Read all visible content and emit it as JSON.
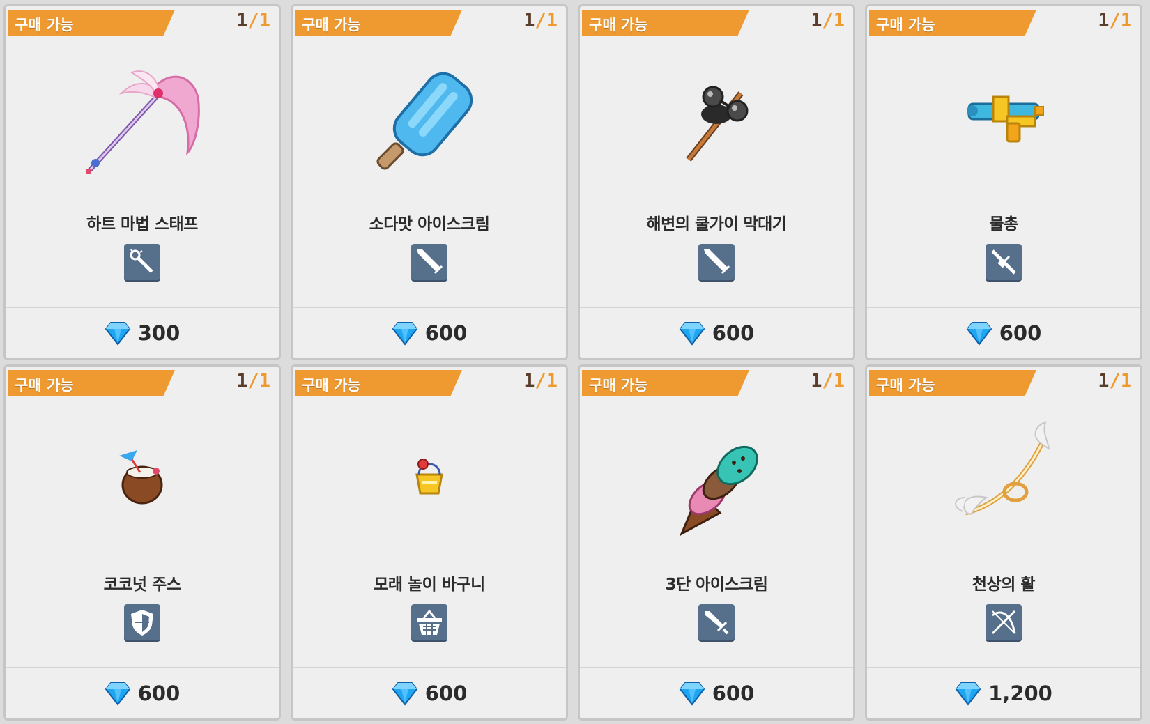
{
  "shop": {
    "badge_label": "구매 가능",
    "colors": {
      "badge": "#ee9a30",
      "type_icon_bg": "#56708c",
      "gem": "#1fa6f0"
    },
    "items": [
      {
        "name": "하트 마법 스태프",
        "count_current": "1",
        "count_sep": "/",
        "count_max": "1",
        "price": "300",
        "type_icon": "magic-staff-type-icon",
        "art": "pink-scythe-staff"
      },
      {
        "name": "소다맛 아이스크림",
        "count_current": "1",
        "count_sep": "/",
        "count_max": "1",
        "price": "600",
        "type_icon": "sword-type-icon",
        "art": "blue-popsicle"
      },
      {
        "name": "해변의 쿨가이 막대기",
        "count_current": "1",
        "count_sep": "/",
        "count_max": "1",
        "price": "600",
        "type_icon": "sword-type-icon",
        "art": "sunglasses-stick"
      },
      {
        "name": "물총",
        "count_current": "1",
        "count_sep": "/",
        "count_max": "1",
        "price": "600",
        "type_icon": "gun-type-icon",
        "art": "water-gun"
      },
      {
        "name": "코코넛 주스",
        "count_current": "1",
        "count_sep": "/",
        "count_max": "1",
        "price": "600",
        "type_icon": "shield-type-icon",
        "art": "coconut-drink"
      },
      {
        "name": "모래 놀이 바구니",
        "count_current": "1",
        "count_sep": "/",
        "count_max": "1",
        "price": "600",
        "type_icon": "basket-type-icon",
        "art": "sand-bucket"
      },
      {
        "name": "3단 아이스크림",
        "count_current": "1",
        "count_sep": "/",
        "count_max": "1",
        "price": "600",
        "type_icon": "short-sword-type-icon",
        "art": "triple-ice-cream"
      },
      {
        "name": "천상의 활",
        "count_current": "1",
        "count_sep": "/",
        "count_max": "1",
        "price": "1,200",
        "type_icon": "bow-type-icon",
        "art": "winged-bow"
      }
    ]
  }
}
